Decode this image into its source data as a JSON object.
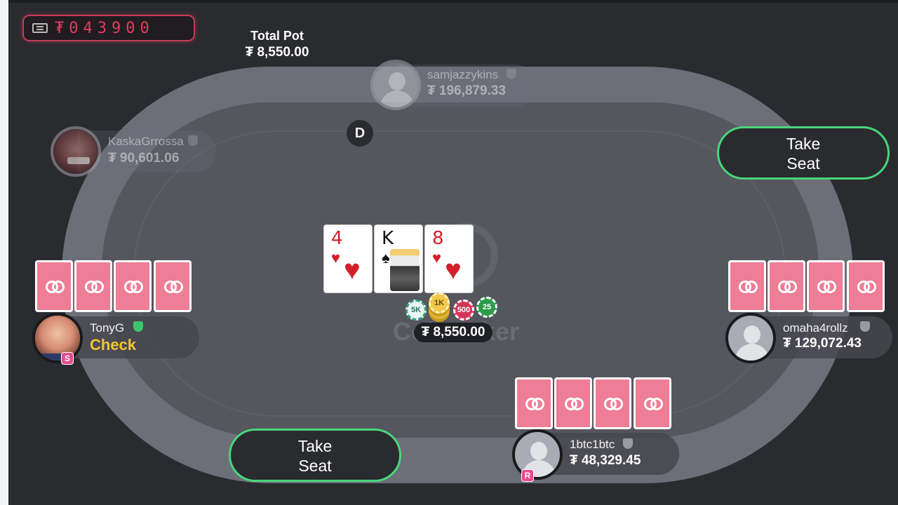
{
  "counter": {
    "icon": "counter-icon",
    "value": "₮043900"
  },
  "pot": {
    "label": "Total Pot",
    "total": "₮ 8,550.00",
    "current": "₮ 8,550.00"
  },
  "table": {
    "watermark": "CoinPoker"
  },
  "dealer_button": "D",
  "players": [
    {
      "name": "samjazzykins",
      "stack": "₮ 196,879.33",
      "state": "sitting-out"
    },
    {
      "name": "KaskaGrrossa",
      "stack": "₮ 90,601.06",
      "state": "sitting-out"
    },
    {
      "name": "TonyG",
      "action": "Check",
      "badge": "S",
      "verified": true
    },
    {
      "name": "omaha4rollz",
      "stack": "₮ 129,072.43"
    },
    {
      "name": "1btc1btc",
      "stack": "₮ 48,329.45",
      "badge": "R"
    }
  ],
  "board": [
    {
      "rank": "4",
      "suit": "♥",
      "color": "#d41f2a"
    },
    {
      "rank": "K",
      "suit": "♠",
      "color": "#111111"
    },
    {
      "rank": "8",
      "suit": "♥",
      "color": "#d41f2a"
    }
  ],
  "chips": [
    "5K",
    "1K",
    "500",
    "25"
  ],
  "take_seat": {
    "label_top": "Take",
    "label_bottom": "Seat"
  },
  "colors": {
    "accent": "#48d67a",
    "card_back": "#ee7d96",
    "counter": "#e23d5e",
    "action": "#f4c531"
  }
}
